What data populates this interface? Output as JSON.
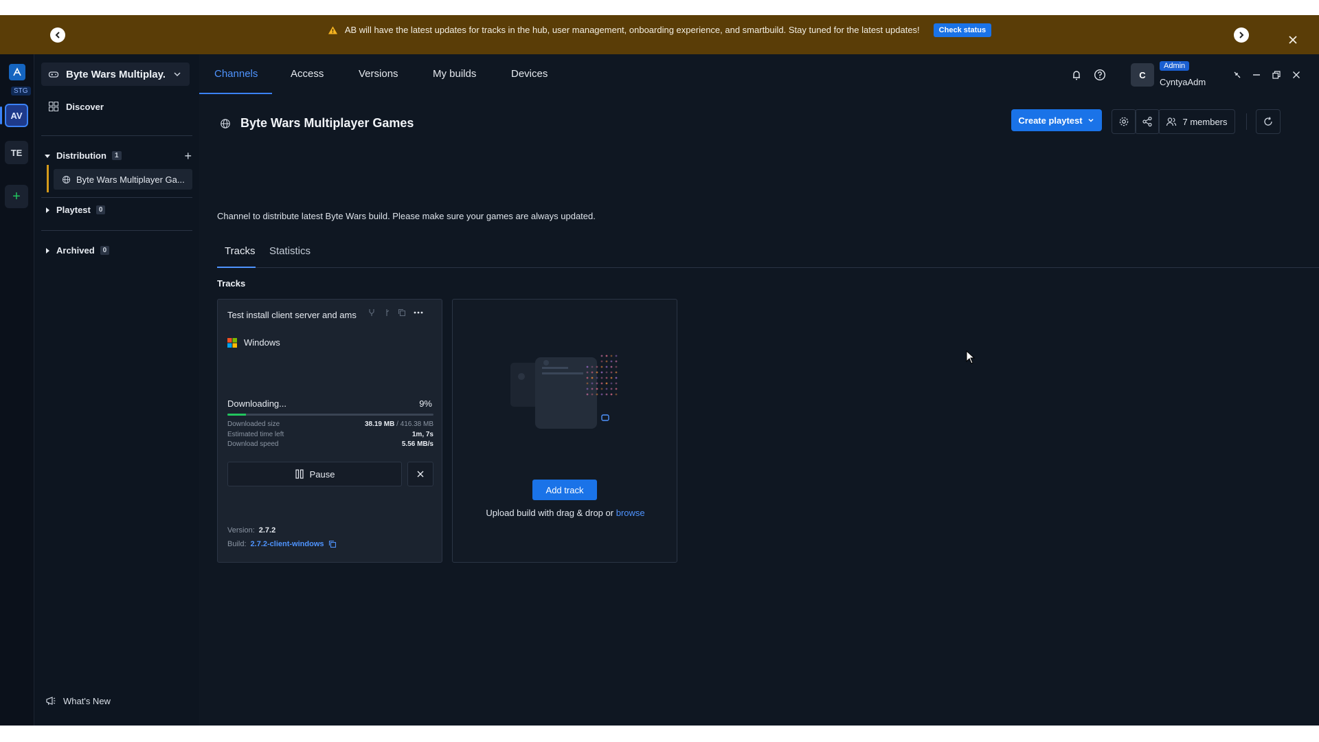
{
  "banner": {
    "message": "AB will have the latest updates for tracks in the hub, user management, onboarding experience, and smartbuild. Stay tuned for the latest updates!",
    "button": "Check status"
  },
  "rail": {
    "env_badge": "STG",
    "items": [
      "AV",
      "TE"
    ]
  },
  "sidebar": {
    "project_name": "Byte Wars Multiplay...",
    "discover": "Discover",
    "groups": [
      {
        "label": "Distribution",
        "count": "1"
      },
      {
        "label": "Playtest",
        "count": "0"
      },
      {
        "label": "Archived",
        "count": "0"
      }
    ],
    "active_channel": "Byte Wars Multiplayer Ga...",
    "whats_new": "What's New"
  },
  "nav": {
    "tabs": [
      "Channels",
      "Access",
      "Versions",
      "My builds",
      "Devices"
    ],
    "active_tab": "Channels",
    "avatar_letter": "C",
    "role_badge": "Admin",
    "username": "CyntyaAdm"
  },
  "channel": {
    "title": "Byte Wars Multiplayer Games",
    "description": "Channel to distribute latest Byte Wars build. Please make sure your games are always updated.",
    "create_button": "Create playtest",
    "members": "7 members",
    "tabs": [
      "Tracks",
      "Statistics"
    ],
    "section_label": "Tracks"
  },
  "track": {
    "title": "Test install client server and ams",
    "platform": "Windows",
    "status": "Downloading...",
    "percent": "9%",
    "progress_fraction": 0.09,
    "downloaded_label": "Downloaded size",
    "downloaded_value": "38.19 MB",
    "total_value": "/ 416.38 MB",
    "eta_label": "Estimated time left",
    "eta_value": "1m, 7s",
    "speed_label": "Download speed",
    "speed_value": "5.56 MB/s",
    "pause": "Pause",
    "version_label": "Version:",
    "version_value": "2.7.2",
    "build_label": "Build:",
    "build_value": "2.7.2-client-windows"
  },
  "add_track": {
    "button": "Add track",
    "hint": "Upload build with drag & drop or",
    "browse": "browse"
  },
  "colors": {
    "accent": "#1a73e8",
    "banner_bg": "#5a3d07",
    "progress": "#22c55e",
    "background": "#0f1722"
  }
}
